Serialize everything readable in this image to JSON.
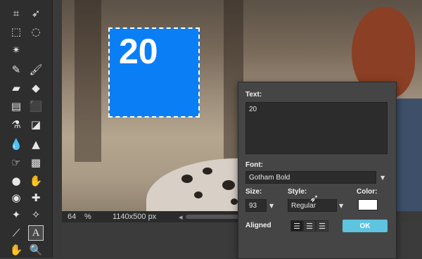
{
  "canvas": {
    "layer_text": "20",
    "layer_color": "#0a7ff5"
  },
  "statusbar": {
    "zoom": "64",
    "zoom_unit": "%",
    "dimensions": "1140x500 px",
    "nav_left": "◂"
  },
  "dialog": {
    "text_label": "Text:",
    "text_value": "20",
    "font_label": "Font:",
    "font_value": "Gotham Bold",
    "size_label": "Size:",
    "size_value": "93",
    "style_label": "Style:",
    "style_value": "Regular",
    "color_label": "Color:",
    "color_value": "#ffffff",
    "aligned_label": "Aligned",
    "ok_label": "OK",
    "dropdown_arrow": "▼"
  },
  "tools": [
    {
      "name": "crop-icon",
      "glyph": "⌗"
    },
    {
      "name": "move-icon",
      "glyph": "➶"
    },
    {
      "name": "marquee-icon",
      "glyph": "⬚"
    },
    {
      "name": "lasso-icon",
      "glyph": "◌"
    },
    {
      "name": "magic-wand-icon",
      "glyph": "✴"
    },
    {
      "name": "pencil-icon",
      "glyph": "✎"
    },
    {
      "name": "brush-icon",
      "glyph": "🖌"
    },
    {
      "name": "eraser-icon",
      "glyph": "▰"
    },
    {
      "name": "bucket-icon",
      "glyph": "◆"
    },
    {
      "name": "gradient-icon",
      "glyph": "▤"
    },
    {
      "name": "stamp-icon",
      "glyph": "⬛"
    },
    {
      "name": "color-replace-icon",
      "glyph": "⚗"
    },
    {
      "name": "drawing-icon",
      "glyph": "◪"
    },
    {
      "name": "blur-icon",
      "glyph": "💧"
    },
    {
      "name": "sharpen-icon",
      "glyph": "▲"
    },
    {
      "name": "smudge-icon",
      "glyph": "☞"
    },
    {
      "name": "sponge-icon",
      "glyph": "▩"
    },
    {
      "name": "dodge-icon",
      "glyph": "●"
    },
    {
      "name": "burn-icon",
      "glyph": "✋"
    },
    {
      "name": "red-eye-icon",
      "glyph": "◉"
    },
    {
      "name": "spot-heal-icon",
      "glyph": "✚"
    },
    {
      "name": "bloat-icon",
      "glyph": "✦"
    },
    {
      "name": "pinch-icon",
      "glyph": "✧"
    },
    {
      "name": "color-picker-icon",
      "glyph": "⟋"
    },
    {
      "name": "type-icon",
      "glyph": "A"
    },
    {
      "name": "hand-icon",
      "glyph": "✋"
    },
    {
      "name": "zoom-icon",
      "glyph": "🔍"
    }
  ]
}
